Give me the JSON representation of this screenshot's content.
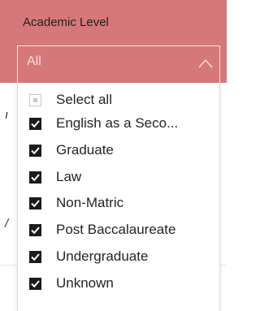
{
  "slicer": {
    "title": "Academic Level",
    "selected_value": "All",
    "header_color": "#d6787a"
  },
  "list": {
    "items": [
      {
        "label": "Select all",
        "state": "partial"
      },
      {
        "label": "English as a Seco...",
        "state": "checked"
      },
      {
        "label": "Graduate",
        "state": "checked"
      },
      {
        "label": "Law",
        "state": "checked"
      },
      {
        "label": "Non-Matric",
        "state": "checked"
      },
      {
        "label": "Post Baccalaureate",
        "state": "checked"
      },
      {
        "label": "Undergraduate",
        "state": "checked"
      },
      {
        "label": "Unknown",
        "state": "checked"
      }
    ]
  },
  "icons": {
    "chevron": "chevron-up-icon",
    "check": "checkmark-icon"
  }
}
